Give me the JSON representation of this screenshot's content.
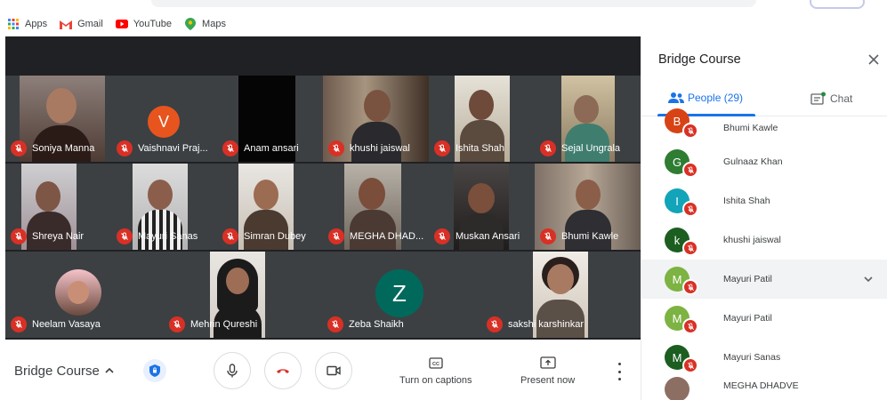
{
  "bookmarks": [
    {
      "label": "Apps",
      "icon": "apps-grid-icon"
    },
    {
      "label": "Gmail",
      "icon": "gmail-icon"
    },
    {
      "label": "YouTube",
      "icon": "youtube-icon"
    },
    {
      "label": "Maps",
      "icon": "maps-icon"
    }
  ],
  "tiles": [
    {
      "name": "Soniya Manna",
      "type": "photo"
    },
    {
      "name": "Vaishnavi Praj...",
      "type": "avatar",
      "initial": "V",
      "color": "#e8541e"
    },
    {
      "name": "Anam ansari",
      "type": "dark"
    },
    {
      "name": "khushi jaiswal",
      "type": "photo"
    },
    {
      "name": "Ishita Shah",
      "type": "photo"
    },
    {
      "name": "Sejal Ungrala",
      "type": "photo"
    },
    {
      "name": "Shreya Nair",
      "type": "photo"
    },
    {
      "name": "Mayuri Sanas",
      "type": "photo"
    },
    {
      "name": "Simran Dubey",
      "type": "photo"
    },
    {
      "name": "MEGHA DHAD...",
      "type": "photo"
    },
    {
      "name": "Muskan Ansari",
      "type": "photo"
    },
    {
      "name": "Bhumi Kawle",
      "type": "photo"
    },
    {
      "name": "Neelam Vasaya",
      "type": "avatar-photo"
    },
    {
      "name": "Mehrin Qureshi",
      "type": "photo"
    },
    {
      "name": "Zeba Shaikh",
      "type": "avatar",
      "initial": "Z",
      "color": "#00695c"
    },
    {
      "name": "sakshi karshinkar",
      "type": "photo"
    }
  ],
  "bottom": {
    "meeting_title": "Bridge Course",
    "captions_label": "Turn on captions",
    "present_label": "Present now"
  },
  "panel": {
    "title": "Bridge Course",
    "people_tab": "People (29)",
    "chat_tab": "Chat",
    "people": [
      {
        "name": "Bhumi Kawle",
        "initial": "B",
        "color": "#d84315"
      },
      {
        "name": "Gulnaaz Khan",
        "initial": "G",
        "color": "#2e7d32"
      },
      {
        "name": "Ishita Shah",
        "initial": "I",
        "color": "#12a4b8"
      },
      {
        "name": "khushi jaiswal",
        "initial": "k",
        "color": "#1b5e20"
      },
      {
        "name": "Mayuri Patil",
        "initial": "M",
        "color": "#7cb342",
        "expanded": true
      },
      {
        "name": "Mayuri Patil",
        "initial": "M",
        "color": "#7cb342"
      },
      {
        "name": "Mayuri Sanas",
        "initial": "M",
        "color": "#1b5e20"
      },
      {
        "name": "MEGHA DHADVE",
        "initial": "",
        "color": "#8d6e63"
      }
    ]
  },
  "colors": {
    "stage_bg": "#202124",
    "muted_red": "#d93025",
    "accent_blue": "#1a73e8"
  }
}
